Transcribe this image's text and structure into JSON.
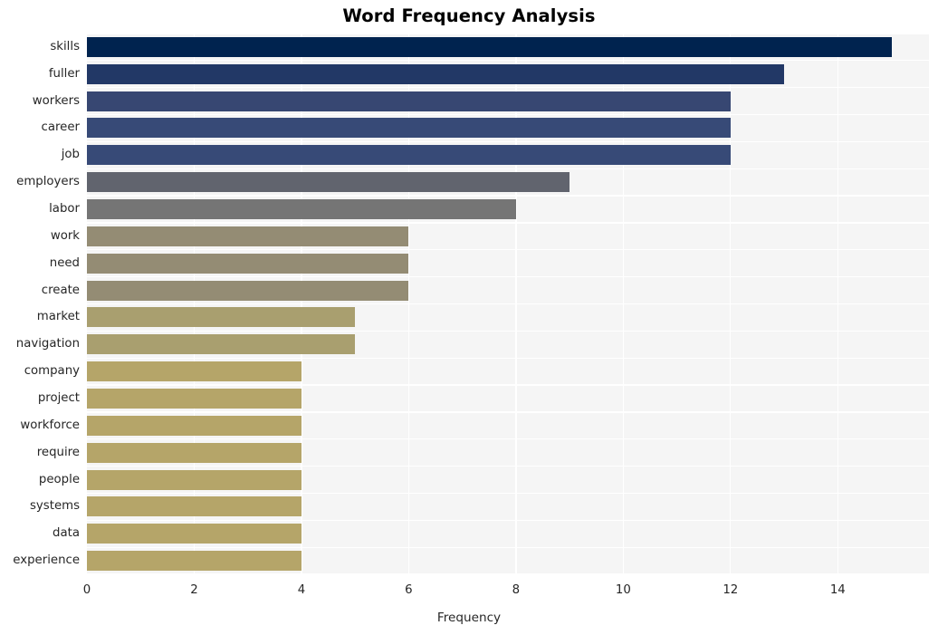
{
  "chart_data": {
    "type": "bar",
    "orientation": "horizontal",
    "title": "Word Frequency Analysis",
    "xlabel": "Frequency",
    "ylabel": "",
    "categories": [
      "skills",
      "fuller",
      "workers",
      "career",
      "job",
      "employers",
      "labor",
      "work",
      "need",
      "create",
      "market",
      "navigation",
      "company",
      "project",
      "workforce",
      "require",
      "people",
      "systems",
      "data",
      "experience"
    ],
    "values": [
      15,
      13,
      12,
      12,
      12,
      9,
      8,
      6,
      6,
      6,
      5,
      5,
      4,
      4,
      4,
      4,
      4,
      4,
      4,
      4
    ],
    "bar_colors": [
      "#00234f",
      "#223866",
      "#374772",
      "#374a77",
      "#374a77",
      "#61646e",
      "#757575",
      "#948c74",
      "#948c74",
      "#948c74",
      "#a99f6f",
      "#a99f6f",
      "#b5a569",
      "#b5a569",
      "#b5a569",
      "#b5a569",
      "#b5a569",
      "#b5a569",
      "#b5a569",
      "#b5a569"
    ],
    "xlim": [
      0,
      15.7
    ],
    "xticks": [
      0,
      2,
      4,
      6,
      8,
      10,
      12,
      14
    ],
    "xtick_labels": [
      "0",
      "2",
      "4",
      "6",
      "8",
      "10",
      "12",
      "14"
    ],
    "grid": true,
    "grid_color": "#ffffff",
    "plot_background": "#f5f5f5",
    "figure_background": "#ffffff",
    "legend": null
  }
}
